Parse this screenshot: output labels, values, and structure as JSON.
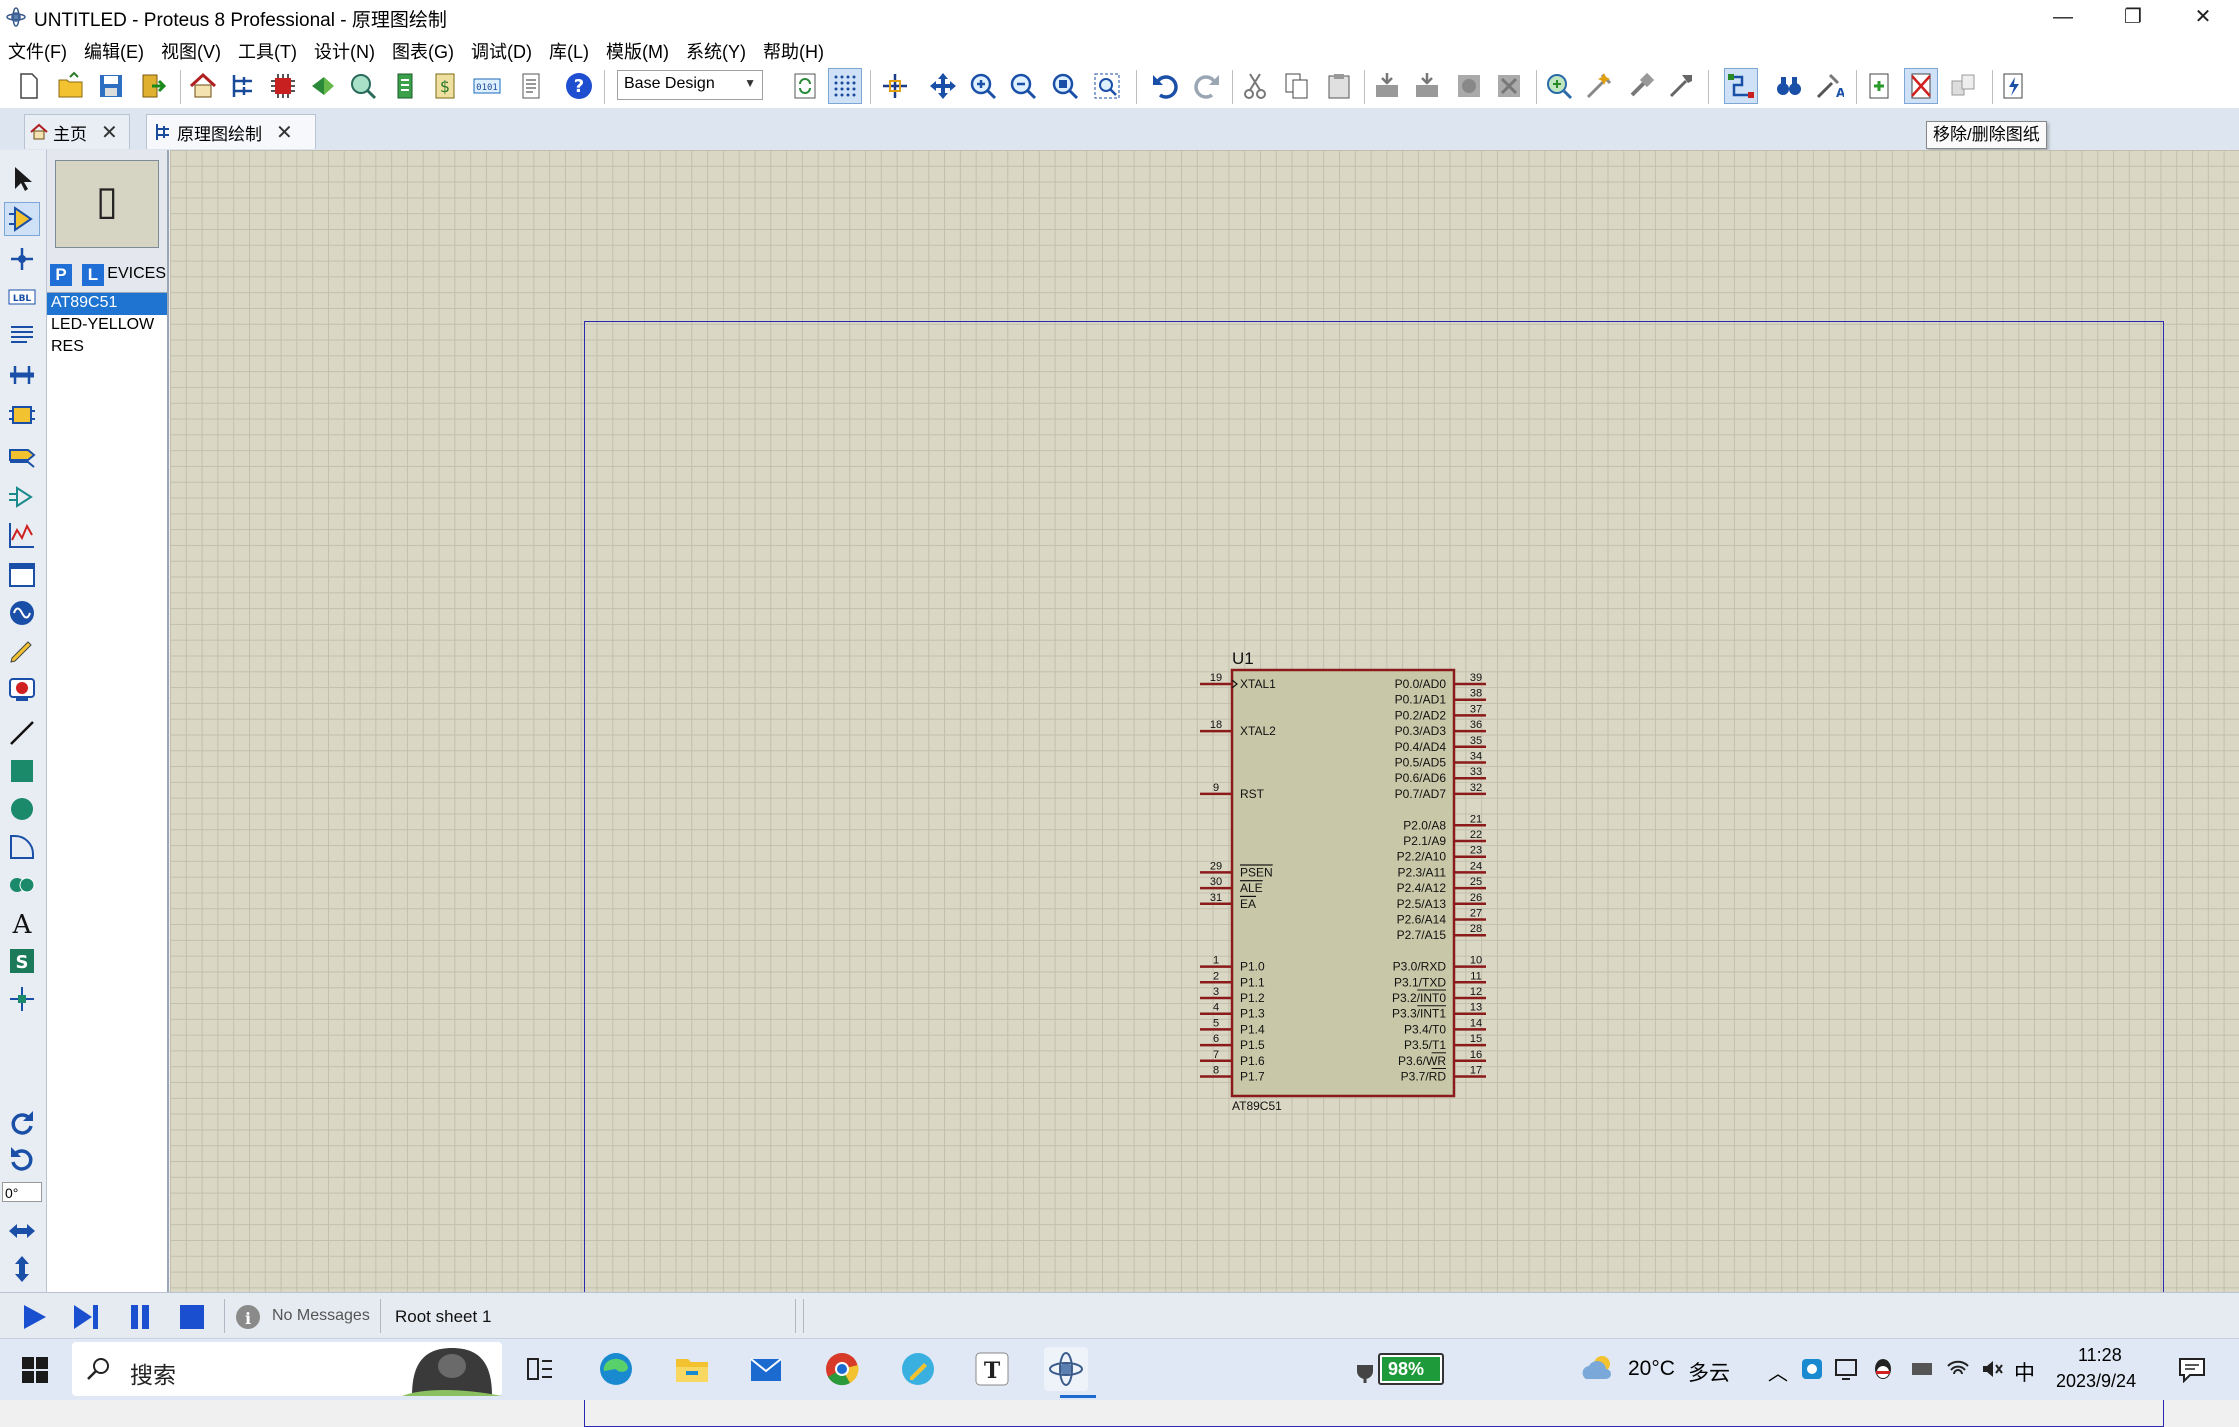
{
  "window": {
    "title": "UNTITLED - Proteus 8 Professional - 原理图绘制",
    "minimize": "—",
    "restore": "❐",
    "close": "✕"
  },
  "menu": [
    "文件(F)",
    "编辑(E)",
    "视图(V)",
    "工具(T)",
    "设计(N)",
    "图表(G)",
    "调试(D)",
    "库(L)",
    "模版(M)",
    "系统(Y)",
    "帮助(H)"
  ],
  "toolbar": {
    "design_select": "Base Design"
  },
  "tabs": [
    {
      "label": "主页",
      "close": "✕"
    },
    {
      "label": "原理图绘制",
      "close": "✕"
    }
  ],
  "tooltip": "移除/删除图纸",
  "device_panel": {
    "p_button": "P",
    "l_button": "L",
    "header": "DEVICES",
    "items": [
      "AT89C51",
      "LED-YELLOW",
      "RES"
    ],
    "selected": "AT89C51",
    "preview_glyph": "▯"
  },
  "rotation": "0°",
  "colors": {
    "canvas": "#dad8c4",
    "component_body": "#c8c8a8",
    "component_border": "#8b1a1a",
    "sheet_border": "#2a2ab0",
    "accent": "#1f6fd6"
  },
  "component": {
    "ref": "U1",
    "part": "AT89C51",
    "left_pins": [
      {
        "num": "19",
        "name": "XTAL1",
        "slot": 0
      },
      {
        "num": "18",
        "name": "XTAL2",
        "slot": 3
      },
      {
        "num": "9",
        "name": "RST",
        "slot": 7
      },
      {
        "num": "29",
        "name": "PSEN",
        "slot": 12,
        "bar": true
      },
      {
        "num": "30",
        "name": "ALE",
        "slot": 13,
        "bar": true
      },
      {
        "num": "31",
        "name": "EA",
        "slot": 14,
        "bar": true
      },
      {
        "num": "1",
        "name": "P1.0",
        "slot": 18
      },
      {
        "num": "2",
        "name": "P1.1",
        "slot": 19
      },
      {
        "num": "3",
        "name": "P1.2",
        "slot": 20
      },
      {
        "num": "4",
        "name": "P1.3",
        "slot": 21
      },
      {
        "num": "5",
        "name": "P1.4",
        "slot": 22
      },
      {
        "num": "6",
        "name": "P1.5",
        "slot": 23
      },
      {
        "num": "7",
        "name": "P1.6",
        "slot": 24
      },
      {
        "num": "8",
        "name": "P1.7",
        "slot": 25
      }
    ],
    "right_pins": [
      {
        "num": "39",
        "name": "P0.0/AD0",
        "slot": 0
      },
      {
        "num": "38",
        "name": "P0.1/AD1",
        "slot": 1
      },
      {
        "num": "37",
        "name": "P0.2/AD2",
        "slot": 2
      },
      {
        "num": "36",
        "name": "P0.3/AD3",
        "slot": 3
      },
      {
        "num": "35",
        "name": "P0.4/AD4",
        "slot": 4
      },
      {
        "num": "34",
        "name": "P0.5/AD5",
        "slot": 5
      },
      {
        "num": "33",
        "name": "P0.6/AD6",
        "slot": 6
      },
      {
        "num": "32",
        "name": "P0.7/AD7",
        "slot": 7
      },
      {
        "num": "21",
        "name": "P2.0/A8",
        "slot": 9
      },
      {
        "num": "22",
        "name": "P2.1/A9",
        "slot": 10
      },
      {
        "num": "23",
        "name": "P2.2/A10",
        "slot": 11
      },
      {
        "num": "24",
        "name": "P2.3/A11",
        "slot": 12
      },
      {
        "num": "25",
        "name": "P2.4/A12",
        "slot": 13
      },
      {
        "num": "26",
        "name": "P2.5/A13",
        "slot": 14
      },
      {
        "num": "27",
        "name": "P2.6/A14",
        "slot": 15
      },
      {
        "num": "28",
        "name": "P2.7/A15",
        "slot": 16
      },
      {
        "num": "10",
        "name": "P3.0/RXD",
        "slot": 18
      },
      {
        "num": "11",
        "name": "P3.1/TXD",
        "slot": 19
      },
      {
        "num": "12",
        "name": "P3.2/INT0",
        "slot": 20,
        "barpart": "INT0"
      },
      {
        "num": "13",
        "name": "P3.3/INT1",
        "slot": 21,
        "barpart": "INT1"
      },
      {
        "num": "14",
        "name": "P3.4/T0",
        "slot": 22
      },
      {
        "num": "15",
        "name": "P3.5/T1",
        "slot": 23
      },
      {
        "num": "16",
        "name": "P3.6/WR",
        "slot": 24,
        "barpart": "WR"
      },
      {
        "num": "17",
        "name": "P3.7/RD",
        "slot": 25,
        "barpart": "RD"
      }
    ]
  },
  "status": {
    "messages": "No Messages",
    "sheet": "Root sheet 1"
  },
  "taskbar": {
    "search_label": "搜索",
    "battery": "98%",
    "weather_temp": "20°C",
    "weather_desc": "多云",
    "ime": "中",
    "time": "11:28",
    "date": "2023/9/24"
  }
}
